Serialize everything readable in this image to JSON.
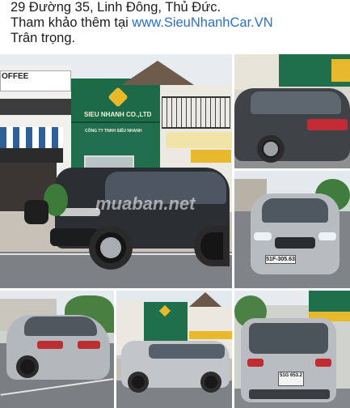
{
  "message": {
    "line1": "29 Đường 35, Linh Đông, Thủ Đức.",
    "line2_prefix": "Tham khảo thêm tại ",
    "line2_link": "www.SieuNhanhCar.VN",
    "line3": "Trân trọng."
  },
  "photos": {
    "main": {
      "store_sign": "SIEU NHANH CO.,LTD",
      "store_subsign": "CÔNG TY TNHH SIÊU NHANH",
      "coffee_sign": "OFFEE",
      "watermark": "muaban.net"
    },
    "top_right": {},
    "mid_right": {
      "plate": "51F-305.63"
    },
    "bottom_left": {},
    "bottom_mid": {},
    "bottom_right": {
      "plate": "51G 653.2"
    }
  },
  "colors": {
    "link": "#2a6fc9",
    "store_green": "#1f6f4c",
    "sign_gold": "#e8b92c"
  }
}
